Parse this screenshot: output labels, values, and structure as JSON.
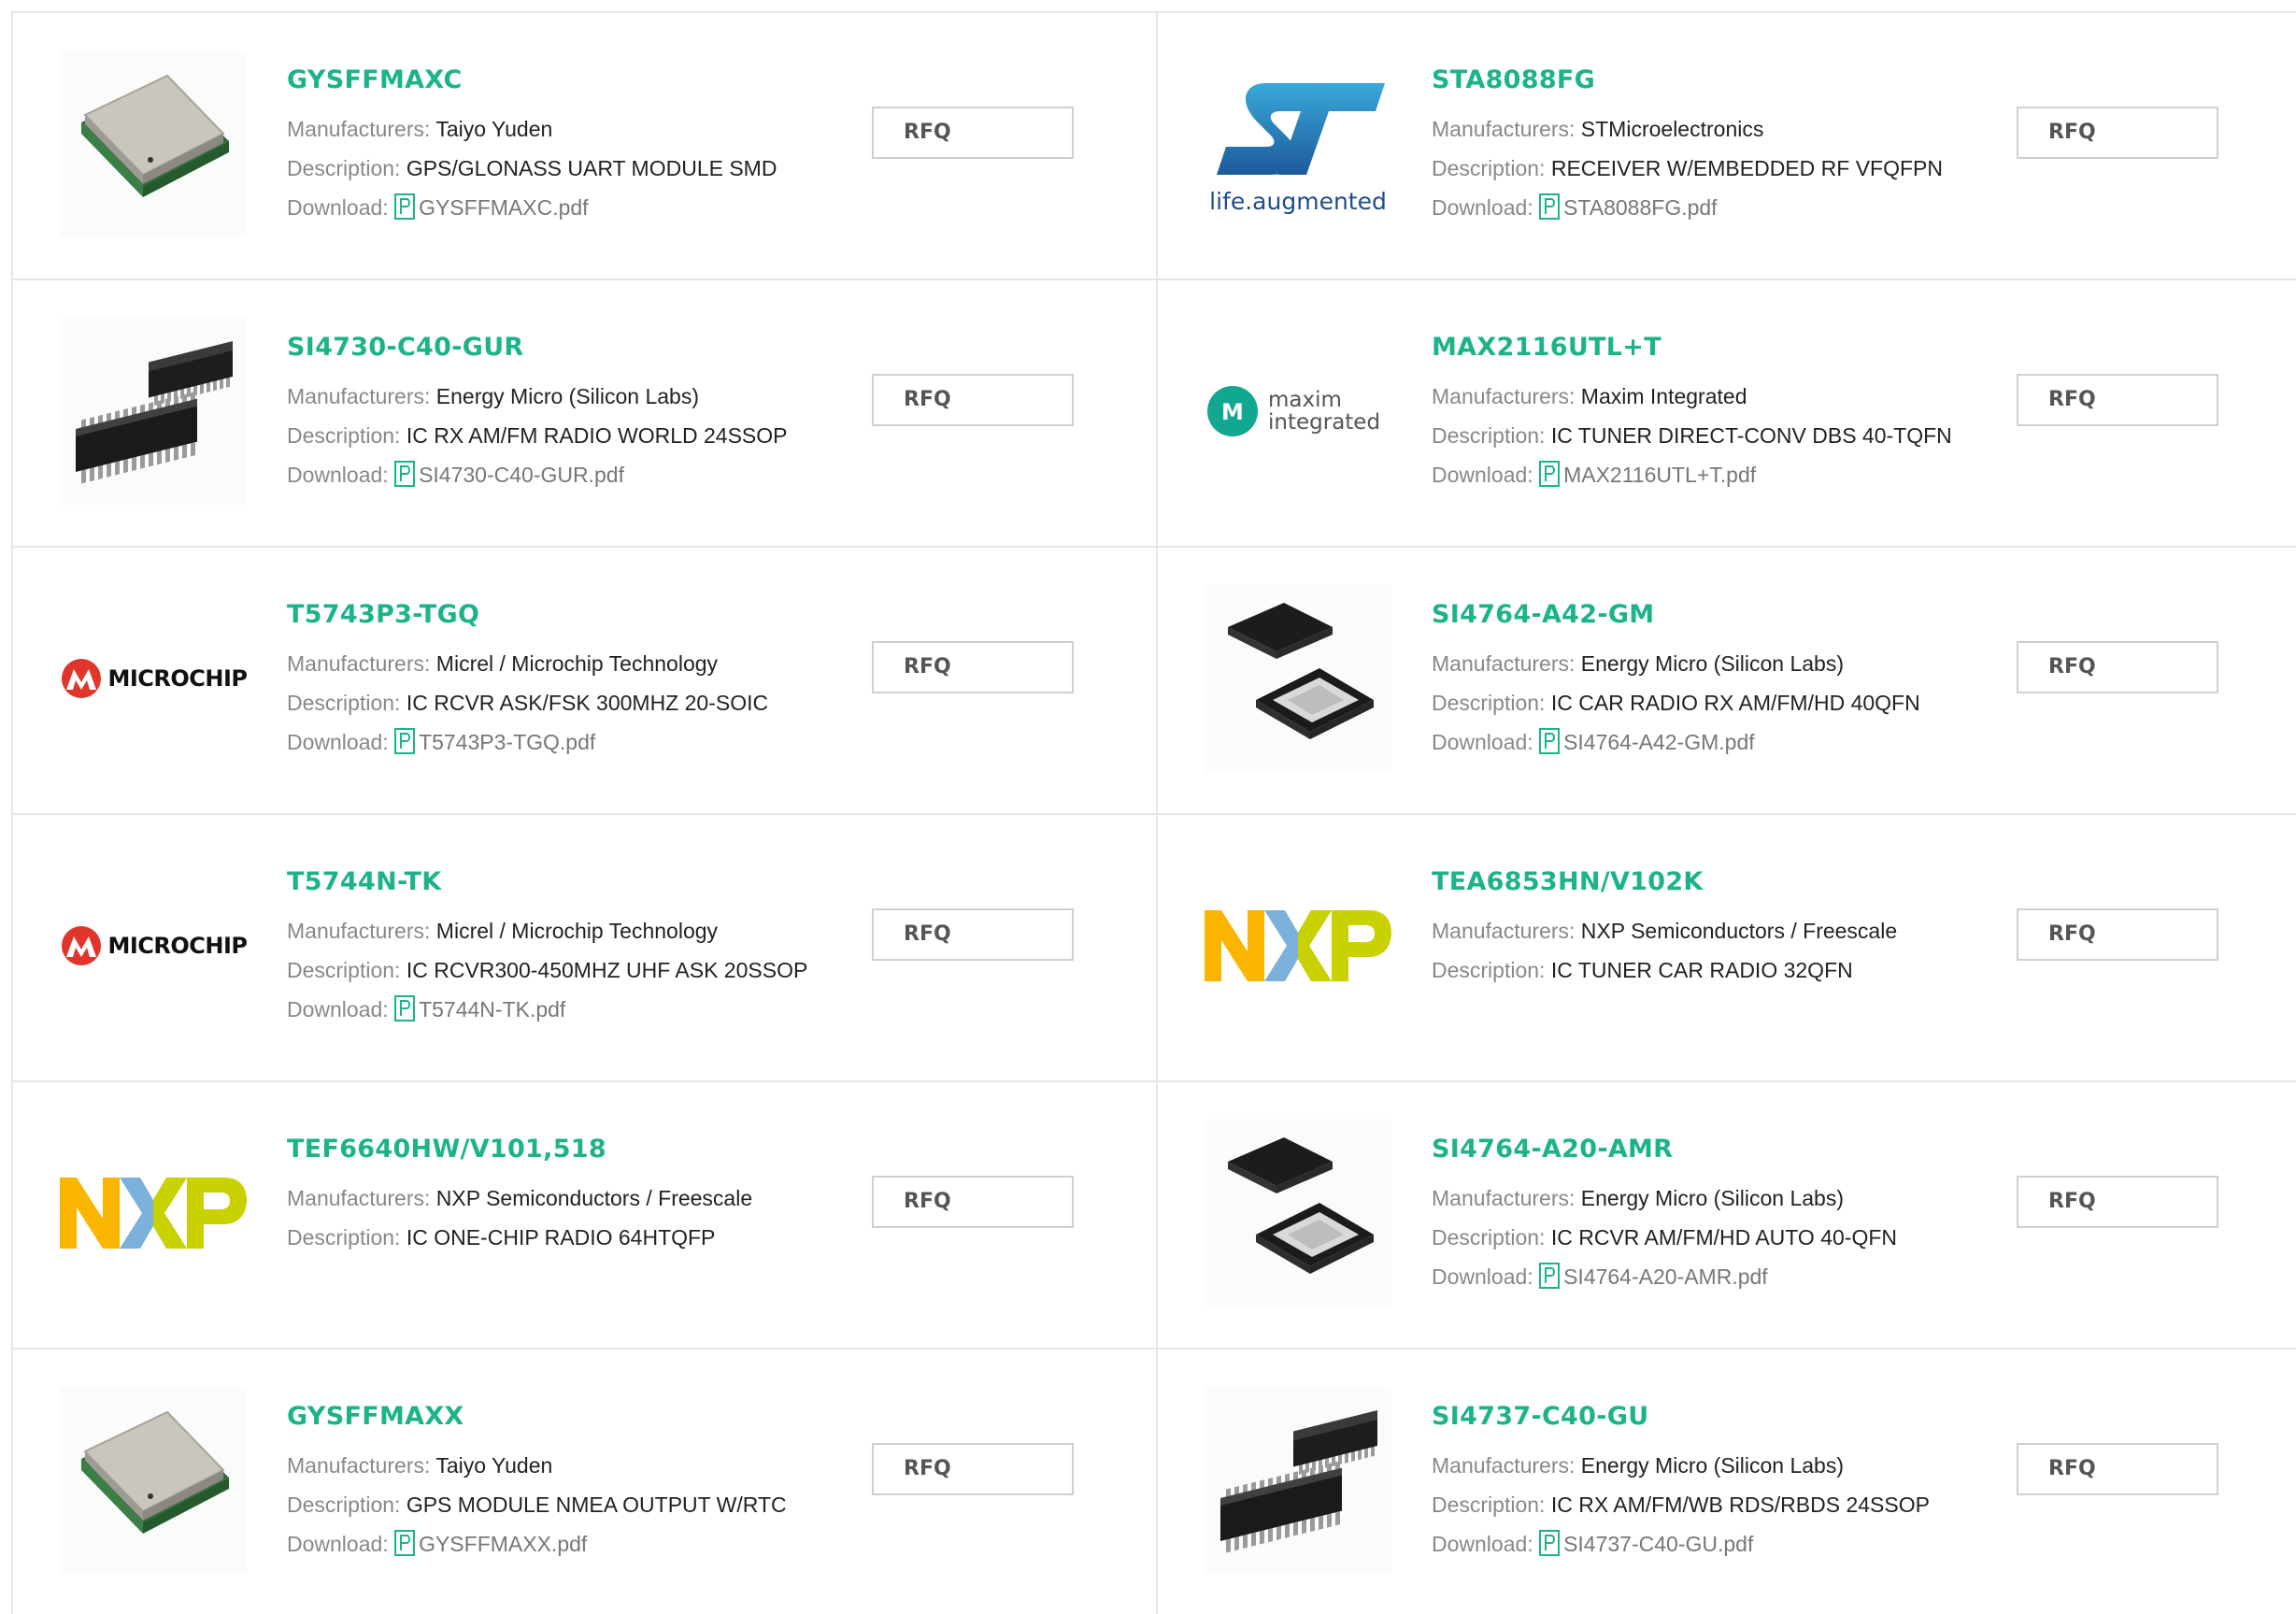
{
  "labels": {
    "manufacturers": "Manufacturers:",
    "description": "Description:",
    "download": "Download:",
    "rfq": "RFQ"
  },
  "colors": {
    "part_number": "#1db38a",
    "label": "#888888",
    "border": "#e6e6e6",
    "pdf_icon": "#1db38a"
  },
  "products": [
    {
      "part": "GYSFFMAXC",
      "manufacturer": "Taiyo Yuden",
      "description": "GPS/GLONASS UART MODULE SMD",
      "download": "GYSFFMAXC.pdf",
      "image": "gps-module-image"
    },
    {
      "part": "STA8088FG",
      "manufacturer": "STMicroelectronics",
      "description": "RECEIVER W/EMBEDDED RF VFQFPN",
      "download": "STA8088FG.pdf",
      "image": "st-logo",
      "logo_text": "life.augmented"
    },
    {
      "part": "SI4730-C40-GUR",
      "manufacturer": "Energy Micro (Silicon Labs)",
      "description": "IC RX AM/FM RADIO WORLD 24SSOP",
      "download": "SI4730-C40-GUR.pdf",
      "image": "ssop-chip-image"
    },
    {
      "part": "MAX2116UTL+T",
      "manufacturer": "Maxim Integrated",
      "description": "IC TUNER DIRECT-CONV DBS 40-TQFN",
      "download": "MAX2116UTL+T.pdf",
      "image": "maxim-logo",
      "logo_text": "maxim integrated"
    },
    {
      "part": "T5743P3-TGQ",
      "manufacturer": "Micrel / Microchip Technology",
      "description": "IC RCVR ASK/FSK 300MHZ 20-SOIC",
      "download": "T5743P3-TGQ.pdf",
      "image": "microchip-logo",
      "logo_text": "MICROCHIP"
    },
    {
      "part": "SI4764-A42-GM",
      "manufacturer": "Energy Micro (Silicon Labs)",
      "description": "IC CAR RADIO RX AM/FM/HD 40QFN",
      "download": "SI4764-A42-GM.pdf",
      "image": "qfn-chip-image"
    },
    {
      "part": "T5744N-TK",
      "manufacturer": "Micrel / Microchip Technology",
      "description": "IC RCVR300-450MHZ UHF ASK 20SSOP",
      "download": "T5744N-TK.pdf",
      "image": "microchip-logo",
      "logo_text": "MICROCHIP"
    },
    {
      "part": "TEA6853HN/V102K",
      "manufacturer": "NXP Semiconductors / Freescale",
      "description": "IC TUNER CAR RADIO 32QFN",
      "download": null,
      "image": "nxp-logo"
    },
    {
      "part": "TEF6640HW/V101,518",
      "manufacturer": "NXP Semiconductors / Freescale",
      "description": "IC ONE-CHIP RADIO 64HTQFP",
      "download": null,
      "image": "nxp-logo"
    },
    {
      "part": "SI4764-A20-AMR",
      "manufacturer": "Energy Micro (Silicon Labs)",
      "description": "IC RCVR AM/FM/HD AUTO 40-QFN",
      "download": "SI4764-A20-AMR.pdf",
      "image": "qfn-chip-image"
    },
    {
      "part": "GYSFFMAXX",
      "manufacturer": "Taiyo Yuden",
      "description": "GPS MODULE NMEA OUTPUT W/RTC",
      "download": "GYSFFMAXX.pdf",
      "image": "gps-module-image"
    },
    {
      "part": "SI4737-C40-GU",
      "manufacturer": "Energy Micro (Silicon Labs)",
      "description": "IC RX AM/FM/WB RDS/RBDS 24SSOP",
      "download": "SI4737-C40-GU.pdf",
      "image": "ssop-chip-image"
    }
  ]
}
